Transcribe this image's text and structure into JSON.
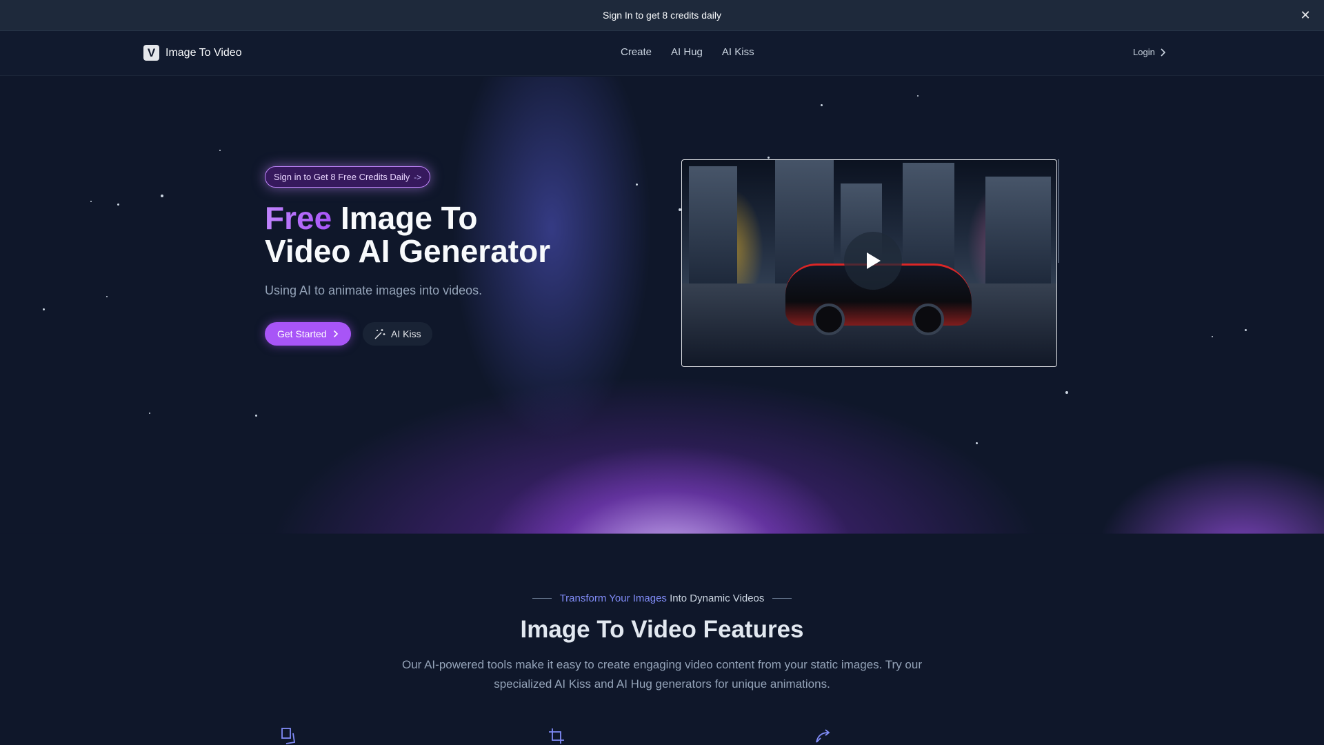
{
  "banner": {
    "text": "Sign In to get 8 credits daily",
    "close_icon": "close-icon"
  },
  "nav": {
    "brand_logo": "V",
    "brand_name": "Image To Video",
    "links": [
      "Create",
      "AI Hug",
      "AI Kiss"
    ],
    "login_label": "Login",
    "login_icon": "chevron-right-icon"
  },
  "hero": {
    "pill_label": "Sign in to Get 8 Free Credits Daily",
    "pill_arrow": "->",
    "title_accent": "Free",
    "title_rest_line1": " Image To",
    "title_line2": "Video AI Generator",
    "subtitle": "Using AI to animate images into videos.",
    "get_started_label": "Get Started",
    "ai_kiss_label": "AI Kiss",
    "video_play_icon": "play-icon"
  },
  "features": {
    "tag_accent": "Transform Your Images",
    "tag_rest": "Into Dynamic Videos",
    "title": "Image To Video Features",
    "description": "Our AI-powered tools make it easy to create engaging video content from your static images. Try our specialized AI Kiss and AI Hug generators for unique animations.",
    "icons": [
      "images-icon",
      "crop-icon",
      "share-icon"
    ]
  },
  "colors": {
    "accent": "#a855f7",
    "background": "#0f172a",
    "banner_bg": "#1e293b",
    "link_accent": "#818cf8"
  }
}
